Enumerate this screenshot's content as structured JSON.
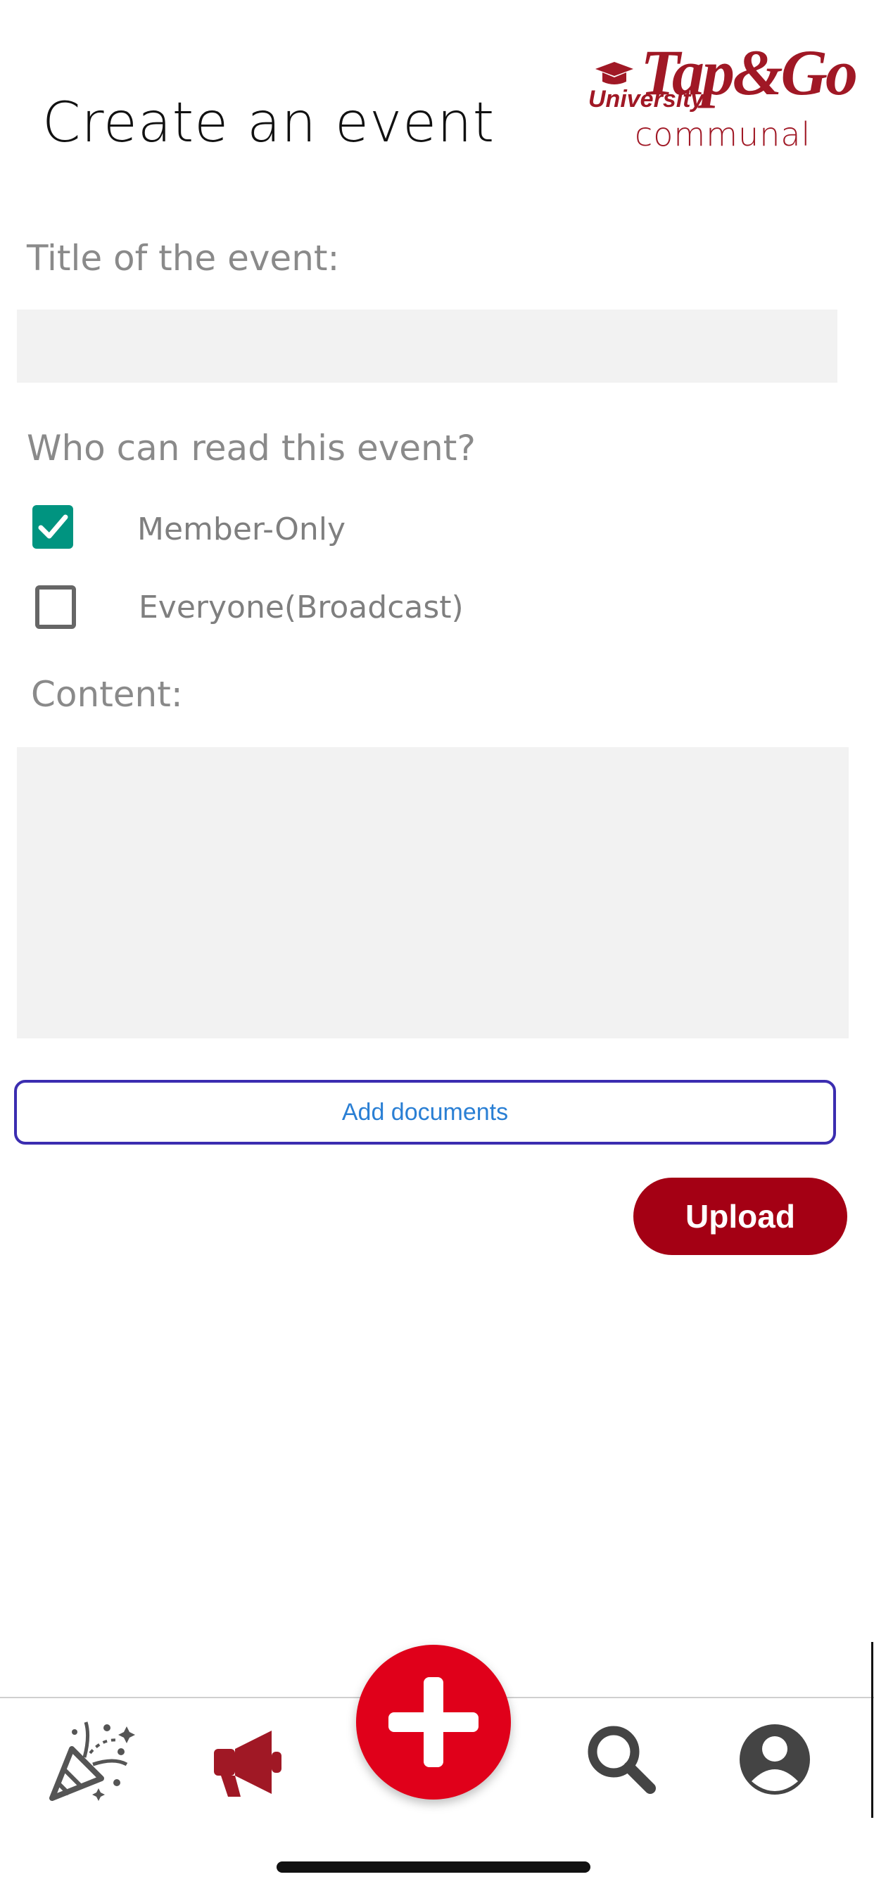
{
  "header": {
    "title": "Create an event",
    "logo": {
      "main": "Tap&Go",
      "prefix": "University",
      "sub": "communal",
      "brand_color": "#a01825"
    }
  },
  "form": {
    "title_label": "Title of the event:",
    "title_value": "",
    "audience_label": "Who can read this event?",
    "options": [
      {
        "label": "Member-Only",
        "checked": true
      },
      {
        "label": "Everyone(Broadcast)",
        "checked": false
      }
    ],
    "content_label": "Content:",
    "content_value": "",
    "add_documents_label": "Add documents",
    "upload_label": "Upload"
  },
  "colors": {
    "accent_red": "#a40014",
    "fab_red": "#e0001a",
    "check_green": "#009480",
    "link_blue": "#2a7fd4"
  },
  "bottom_nav": {
    "items": [
      {
        "icon": "party-popper-icon"
      },
      {
        "icon": "megaphone-icon",
        "active": true
      },
      {
        "icon": "plus-icon"
      },
      {
        "icon": "search-icon"
      },
      {
        "icon": "profile-icon"
      }
    ]
  }
}
